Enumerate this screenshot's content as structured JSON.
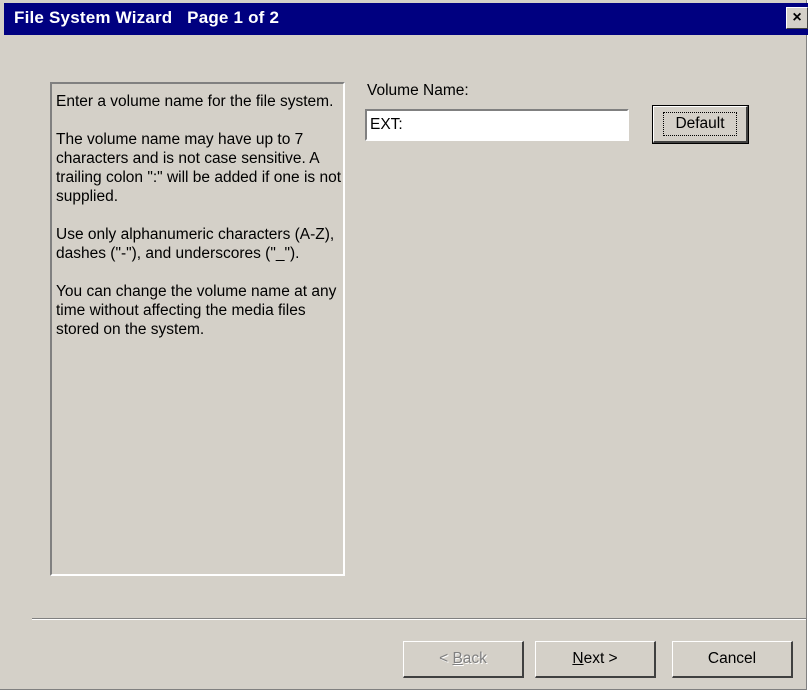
{
  "window": {
    "title": "File System Wizard   Page 1 of 2",
    "close_glyph": "×"
  },
  "help": {
    "paragraphs": [
      "Enter a volume name for the file system.",
      "The volume name may have up to 7 characters and is not case sensitive. A trailing colon \":\" will be added if one is not supplied.",
      "Use only alphanumeric characters (A-Z), dashes (\"-\"), and underscores (\"_\").",
      "You can change the volume name at any time without affecting the media files stored on the system."
    ]
  },
  "volume": {
    "label": "Volume Name:",
    "value": "EXT:"
  },
  "buttons": {
    "default_label": "Default",
    "back_mnemonic": "B",
    "back_rest": "ack",
    "back_prefix": "< ",
    "next_mnemonic": "N",
    "next_rest": "ext >",
    "cancel_label": "Cancel"
  }
}
